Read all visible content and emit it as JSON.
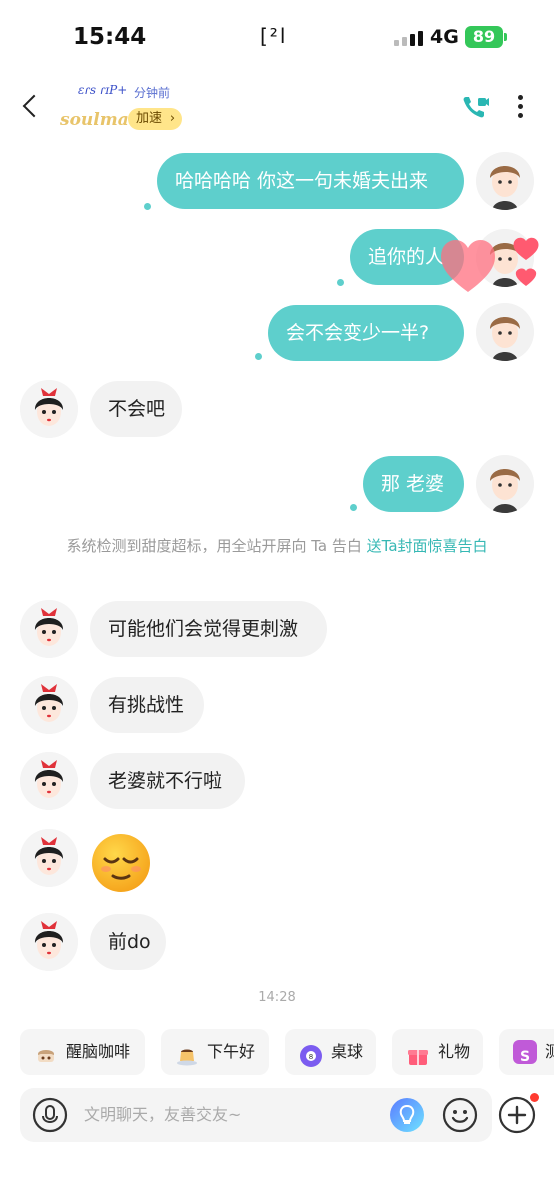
{
  "status_bar": {
    "time": "15:44",
    "center_glyph": "[²l",
    "network": "4G",
    "battery": "89",
    "battery_color": "#34c759"
  },
  "header": {
    "contact_name_scribble": "ɛɾs ɾɪP+",
    "last_seen": "分钟前",
    "brand": "soulmate",
    "boost_label": "加速",
    "boost_chevron": "›",
    "call_icon": "video-call-icon",
    "more_icon": "more-vertical-icon"
  },
  "messages": [
    {
      "from": "me",
      "text": "哈哈哈哈 你这一句未婚夫出来"
    },
    {
      "from": "me",
      "text": "追你的人"
    },
    {
      "from": "me",
      "text": "会不会变少一半?"
    },
    {
      "from": "them",
      "text": "不会吧"
    },
    {
      "from": "me",
      "text": "那 老婆"
    },
    {
      "from": "them",
      "text": "可能他们会觉得更刺激"
    },
    {
      "from": "them",
      "text": "有挑战性"
    },
    {
      "from": "them",
      "text": "老婆就不行啦"
    },
    {
      "from": "them",
      "emoji": "relieved-face"
    },
    {
      "from": "them",
      "text": "前do"
    }
  ],
  "system_notice": {
    "text": "系统检测到甜度超标，用全站开屏向 Ta 告白",
    "link": "送Ta封面惊喜告白"
  },
  "timestamp": "14:28",
  "quick_chips": [
    {
      "label": "醒脑咖啡",
      "icon": "coffee-icon"
    },
    {
      "label": "下午好",
      "icon": "pudding-icon"
    },
    {
      "label": "桌球",
      "icon": "billiard-ball-icon"
    },
    {
      "label": "礼物",
      "icon": "gift-icon"
    },
    {
      "label": "测",
      "icon": "test-icon"
    }
  ],
  "input": {
    "placeholder": "文明聊天，友善交友~"
  },
  "colors": {
    "accent": "#5ecfcc",
    "link": "#36b8b4",
    "boost": "#ffe58a"
  }
}
